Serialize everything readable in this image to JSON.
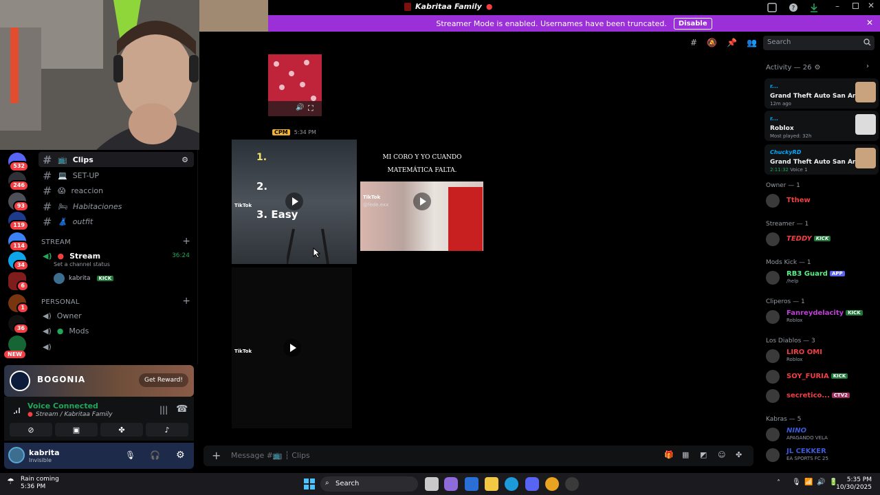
{
  "window": {
    "title": "Kabritaa Family"
  },
  "banner": {
    "text": "Streamer Mode is enabled. Usernames have been truncated.",
    "button": "Disable"
  },
  "search": {
    "placeholder": "Search"
  },
  "servers": [
    {
      "badge": "532"
    },
    {
      "badge": "246"
    },
    {
      "badge": "93"
    },
    {
      "badge": "119"
    },
    {
      "badge": "114"
    },
    {
      "badge": "34"
    },
    {
      "badge": "6"
    },
    {
      "badge": "1"
    },
    {
      "badge": "36"
    },
    {
      "badge": "NEW"
    }
  ],
  "channels": {
    "text": [
      {
        "label": "Clips",
        "emoji": "📺"
      },
      {
        "label": "SET-UP",
        "emoji": "💻"
      },
      {
        "label": "reaccion",
        "emoji": "😱"
      },
      {
        "label": "Habitaciones",
        "emoji": "🛏"
      },
      {
        "label": "outfit",
        "emoji": "👗"
      }
    ],
    "stream_category": "STREAM",
    "stream_channel": {
      "label": "Stream",
      "time": "36:24",
      "status": "Set a channel status"
    },
    "stream_user": {
      "name": "kabrita",
      "tag": "KICK"
    },
    "personal_category": "PERSONAL",
    "personal": [
      {
        "label": "Owner"
      },
      {
        "label": "Mods"
      },
      {
        "label": ""
      }
    ]
  },
  "reward": {
    "brand": "BOGONIA",
    "button": "Get Reward!"
  },
  "voice": {
    "status": "Voice Connected",
    "location": "Stream / Kabritaa Family"
  },
  "user": {
    "name": "kabrita",
    "status": "Invisible"
  },
  "chat": {
    "message_author_tag": "CPM",
    "message_time": "5:34 PM",
    "video1": {
      "lines": [
        "1.",
        "2.",
        "3. Easy"
      ],
      "brand": "TikTok"
    },
    "video2": {
      "caption": "MI CORO Y YO CUANDO MATEMÁTICA FALTA.",
      "brand": "TikTok",
      "handle": "@fede.exx"
    },
    "video3": {
      "brand": "TikTok"
    },
    "composer_placeholder": "Message #📺 ┆ Clips"
  },
  "members": {
    "activity_header": "Activity — 26",
    "activities": [
      {
        "name": "r...",
        "game": "Grand Theft Auto San Andr...",
        "time": "12m ago"
      },
      {
        "name": "r...",
        "game": "Roblox",
        "time": "Most played: 32h"
      },
      {
        "name": "ChuckyRD",
        "game": "Grand Theft Auto San Andr...",
        "time": "2:11:32",
        "extra": "Voice 1"
      }
    ],
    "groups": [
      {
        "header": "Owner — 1",
        "members": [
          {
            "name": "Tthew",
            "color": "#f23f43"
          }
        ]
      },
      {
        "header": "Streamer — 1",
        "members": [
          {
            "name": "TEDDY",
            "color": "#f23f43",
            "tag": "KICK"
          }
        ]
      },
      {
        "header": "Mods Kick — 1",
        "members": [
          {
            "name": "RB3 Guard",
            "color": "#57f287",
            "status": "/help",
            "tag": "APP"
          }
        ]
      },
      {
        "header": "Cliperos — 1",
        "members": [
          {
            "name": "Fanreydelacity",
            "color": "#c13fd9",
            "status": "Roblox",
            "tag": "KICK"
          }
        ]
      },
      {
        "header": "Los Diablos — 3",
        "members": [
          {
            "name": "LIRO OMI",
            "color": "#f23f43",
            "status": "Roblox"
          },
          {
            "name": "SOY_FURIA",
            "color": "#f23f43",
            "tag": "KICK"
          },
          {
            "name": "secretico...",
            "color": "#f23f43",
            "tag": "CTV2"
          }
        ]
      },
      {
        "header": "Kabras — 5",
        "members": [
          {
            "name": "NINO",
            "color": "#3b5bdb",
            "status": "APAGANDO VELA"
          },
          {
            "name": "JL CEKKER",
            "color": "#3b5bdb",
            "status": "EA SPORTS FC 25"
          }
        ]
      }
    ]
  },
  "taskbar": {
    "weather": "Rain coming",
    "weather_time": "5:36 PM",
    "search": "Search",
    "time": "5:35 PM",
    "date": "10/30/2025"
  },
  "colors": {
    "accent": "#9b30d9",
    "online": "#23a55a",
    "mention": "#f23f43"
  }
}
